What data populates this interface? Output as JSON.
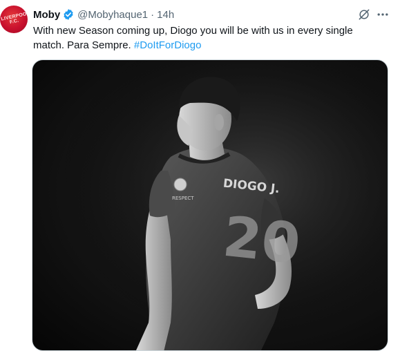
{
  "author": {
    "display_name": "Moby",
    "handle": "@Mobyhaque1",
    "separator": "·",
    "time": "14h",
    "avatar_text": "LIVERPOOL F.C."
  },
  "icons": {
    "verified": "verified-badge-icon",
    "grok": "grok-icon",
    "more": "more-options-icon"
  },
  "tweet": {
    "text_line1": "With new Season coming up, Diogo you will be with us in every single",
    "text_line2": "match. Para Sempre.",
    "hashtag": "#DoItForDiogo"
  },
  "media": {
    "shirt_name": "DIOGO J.",
    "shirt_number": "20",
    "sleeve_text": "RESPECT"
  },
  "colors": {
    "accent": "#1d9bf0",
    "text_primary": "#0f1419",
    "text_secondary": "#536471"
  }
}
